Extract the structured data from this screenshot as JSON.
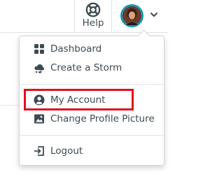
{
  "header": {
    "help_label": "Help"
  },
  "user_menu": {
    "avatar_alt": "User profile picture"
  },
  "dropdown": {
    "items": [
      {
        "label": "Dashboard",
        "icon": "dashboard-grid-icon"
      },
      {
        "label": "Create a Storm",
        "icon": "storm-cloud-icon"
      },
      {
        "label": "My Account",
        "icon": "account-circle-icon",
        "highlighted": true
      },
      {
        "label": "Change Profile Picture",
        "icon": "image-icon"
      },
      {
        "label": "Logout",
        "icon": "logout-icon"
      }
    ]
  },
  "colors": {
    "text": "#3d4a52",
    "highlight_border": "#e0101d",
    "avatar_ring": "#1a9ab3"
  }
}
